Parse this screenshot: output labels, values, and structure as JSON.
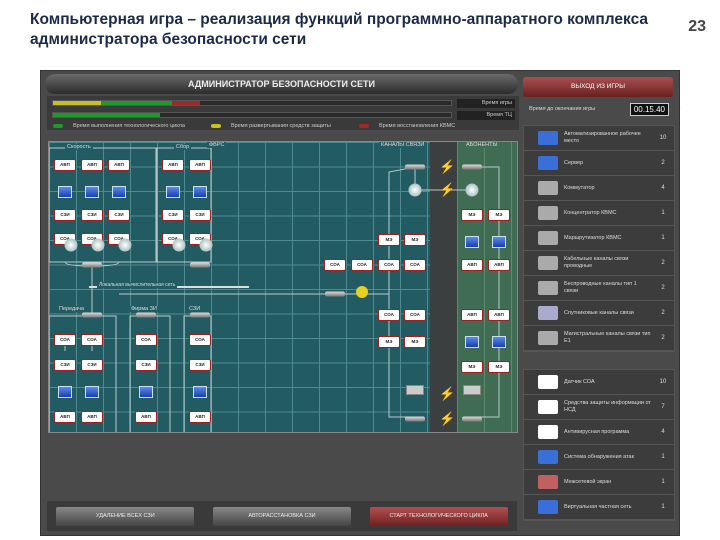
{
  "slide": {
    "title": "Компьютерная игра – реализация функций программно-аппаратного комплекса администратора безопасности сети",
    "page": "23"
  },
  "header": {
    "title": "АДМИНИСТРАТОР БЕЗОПАСНОСТИ СЕТИ"
  },
  "progress": {
    "game_label": "Время игры",
    "tc_label": "Время ТЦ",
    "game_segments": [
      {
        "color": "#c8c020",
        "from": 0,
        "to": 12
      },
      {
        "color": "#1f9a2a",
        "from": 12,
        "to": 30
      },
      {
        "color": "#a02828",
        "from": 30,
        "to": 37
      }
    ],
    "tc_percent": 27,
    "tc_color": "#1f9a2a"
  },
  "legend": [
    {
      "label": "Время выполнения технологического цикла",
      "color": "#1f9a2a"
    },
    {
      "label": "Время развертывания средств защиты",
      "color": "#c8c020"
    },
    {
      "label": "Время восстановления КВМС",
      "color": "#a02828"
    }
  ],
  "grid": {
    "groups": [
      "Скорость",
      "Сбор",
      "ФВРС",
      "КАНАЛЫ СВЯЗИ",
      "АБОНЕНТЫ",
      "Передача",
      "Фирма ЗИ",
      "СЗИ",
      "Локальная вычислительная сеть"
    ],
    "node_labels": {
      "avp": "АВП",
      "soa": "СОА",
      "szi": "СЗИ НСД",
      "me": "МЭ"
    }
  },
  "right": {
    "exit_label": "ВЫХОД ИЗ ИГРЫ",
    "time_label": "Время до окончания игры",
    "time_value": "00.15.40",
    "equipment": [
      {
        "label": "Автоматизированное рабочее место",
        "count": "10",
        "icon": "workstation-icon"
      },
      {
        "label": "Сервер",
        "count": "2",
        "icon": "server-icon"
      },
      {
        "label": "Коммутатор",
        "count": "4",
        "icon": "switch-icon"
      },
      {
        "label": "Концентратор КВМС",
        "count": "1",
        "icon": "hub-icon"
      },
      {
        "label": "Маршрутизатор КВМС",
        "count": "1",
        "icon": "router-icon"
      },
      {
        "label": "Кабельные каналы связи проводные",
        "count": "2",
        "icon": "cable-icon"
      },
      {
        "label": "Беспроводные каналы тип 1 связи",
        "count": "2",
        "icon": "wireless-icon"
      },
      {
        "label": "Спутниковые каналы связи",
        "count": "2",
        "icon": "satellite-icon"
      },
      {
        "label": "Магистральные каналы связи тип Е1",
        "count": "2",
        "icon": "trunk-icon"
      }
    ],
    "protection": [
      {
        "label": "Датчик СОА",
        "count": "10",
        "icon": "ids-sensor-icon"
      },
      {
        "label": "Средства защиты информации от НСД",
        "count": "7",
        "icon": "szi-icon"
      },
      {
        "label": "Антивирусная программа",
        "count": "4",
        "icon": "antivirus-icon"
      },
      {
        "label": "Система обнаружения атак",
        "count": "1",
        "icon": "ids-icon"
      },
      {
        "label": "Межсетевой экран",
        "count": "1",
        "icon": "firewall-icon"
      },
      {
        "label": "Виртуальная частная сеть",
        "count": "1",
        "icon": "vpn-icon"
      }
    ]
  },
  "buttons": {
    "remove_all": "УДАЛЕНИЕ ВСЕХ СЗИ",
    "auto_place": "АВТОРАССТАНОВКА СЗИ",
    "start": "СТАРТ ТЕХНОЛОГИЧЕСКОГО ЦИКЛА"
  }
}
